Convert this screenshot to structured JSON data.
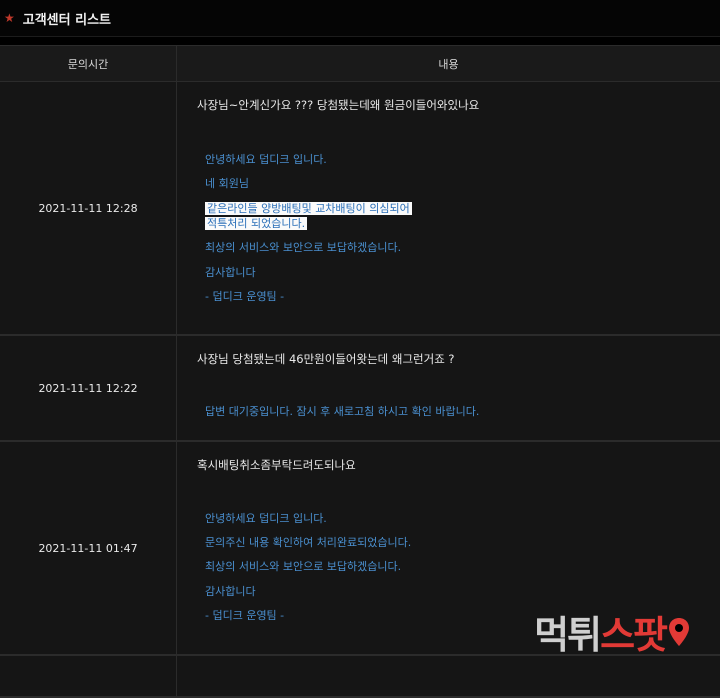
{
  "header": {
    "title": "고객센터 리스트",
    "icon": "star-icon"
  },
  "columns": {
    "time": "문의시간",
    "content": "내용"
  },
  "rows": [
    {
      "time": "2021-11-11 12:28",
      "question": "사장님~안계신가요 ??? 당첨됐는데왜 원금이들어와있나요",
      "answer": [
        "안녕하세요 덥디크 입니다.",
        "네 회원님",
        "같은라인들 양방배팅및 교차배팅이 의심되어",
        "적특처리 되었습니다.",
        "최상의 서비스와 보안으로 보답하겠습니다.",
        "감사합니다",
        "- 덥디크 운영팀 -"
      ]
    },
    {
      "time": "2021-11-11 12:22",
      "question": "사장님 당첨됐는데 46만원이들어왓는데 왜그런거죠 ?",
      "answer": [
        "답변 대기중입니다. 잠시 후 새로고침 하시고 확인 바랍니다."
      ]
    },
    {
      "time": "2021-11-11 01:47",
      "question": "혹시배팅취소좀부탁드려도되나요",
      "answer": [
        "안녕하세요 덥디크 입니다.",
        "문의주신 내용 확인하여 처리완료되었습니다.",
        "최상의 서비스와 보안으로 보답하겠습니다.",
        "감사합니다",
        "- 덥디크 운영팀 -"
      ]
    }
  ],
  "watermark": {
    "part1": "먹튀",
    "part2": "스팟"
  },
  "colors": {
    "accent": "#4a90d0",
    "star": "#c0392b",
    "watermark_red": "#e23a36"
  }
}
